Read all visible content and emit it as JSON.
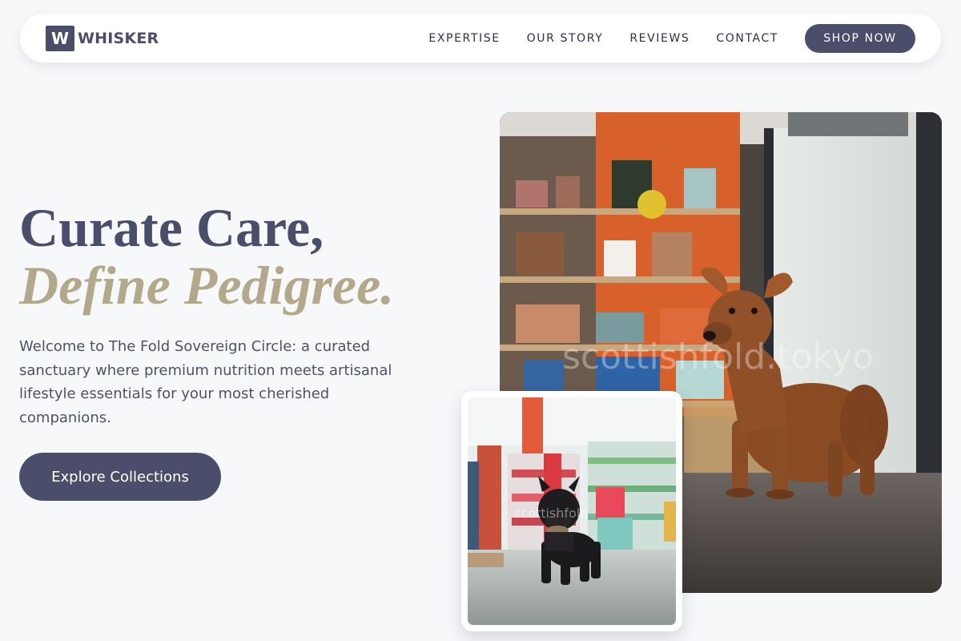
{
  "brand": {
    "logo_letter": "W",
    "name": "WHISKER"
  },
  "nav": {
    "links": [
      "EXPERTISE",
      "OUR STORY",
      "REVIEWS",
      "CONTACT"
    ],
    "cta": "SHOP NOW"
  },
  "hero": {
    "title_line1": "Curate Care,",
    "title_line2": "Define Pedigree.",
    "description": "Welcome to The Fold Sovereign Circle: a curated sanctuary where premium nutrition meets artisanal lifestyle essentials for your most cherished companions.",
    "cta": "Explore Collections"
  },
  "images": {
    "main": {
      "watermark": "scottishfold.tokyo",
      "icon": "photo-dog-in-pet-shop"
    },
    "inset": {
      "watermark": "scottishfold",
      "icon": "photo-bulldog-in-store"
    }
  },
  "colors": {
    "primary": "#4b4e6a",
    "accent_gold": "#b2a98a",
    "background": "#f7f8fa"
  }
}
